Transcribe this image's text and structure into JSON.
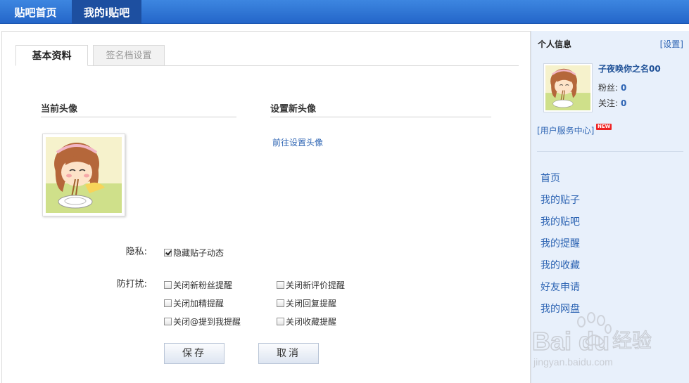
{
  "nav": {
    "tabs": [
      "贴吧首页",
      "我的i贴吧"
    ]
  },
  "main": {
    "tabs": [
      "基本资料",
      "签名档设置"
    ],
    "current_avatar_title": "当前头像",
    "new_avatar_title": "设置新头像",
    "set_avatar_link": "前往设置头像",
    "privacy_label": "隐私:",
    "privacy_option": "隐藏贴子动态",
    "antidisturb_label": "防打扰:",
    "options": [
      "关闭新粉丝提醒",
      "关闭新评价提醒",
      "关闭加精提醒",
      "关闭回复提醒",
      "关闭@提到我提醒",
      "关闭收藏提醒"
    ],
    "save_label": "保存",
    "cancel_label": "取消"
  },
  "sidebar": {
    "title": "个人信息",
    "settings_link": "[设置]",
    "username": "子夜唤你之名00",
    "fans_label": "粉丝:",
    "fans_value": "0",
    "follow_label": "关注:",
    "follow_value": "0",
    "service_link": "[用户服务中心]",
    "new_badge": "NEW",
    "menu": [
      "首页",
      "我的贴子",
      "我的贴吧",
      "我的提醒",
      "我的收藏",
      "好友申请",
      "我的网盘"
    ]
  },
  "watermark": {
    "logo": "Baidu经验",
    "url": "jingyan.baidu.com"
  },
  "colors": {
    "nav_bg": "#2f73d6",
    "nav_active": "#1d4fa0",
    "link": "#2d64b3",
    "sidebar_bg": "#e8f0fb"
  }
}
